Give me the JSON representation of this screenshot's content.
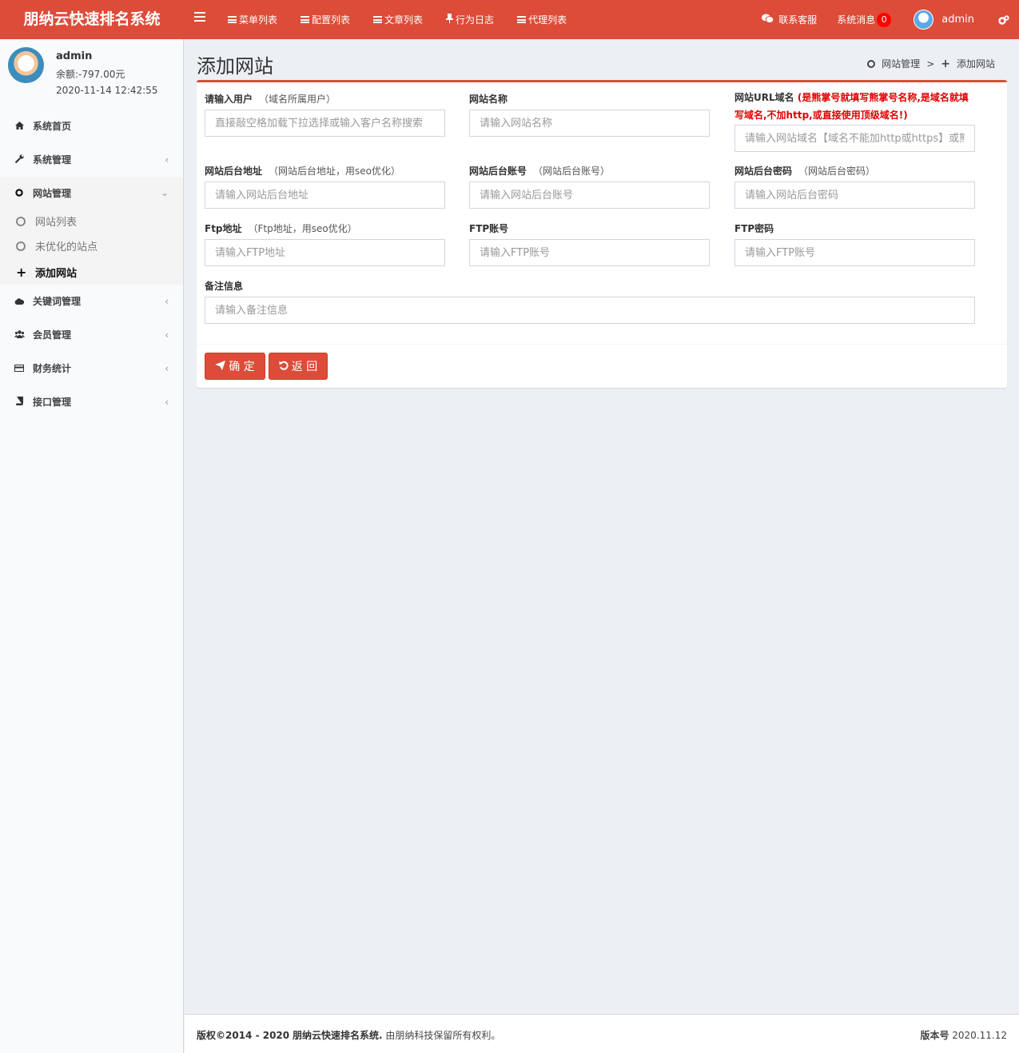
{
  "app": {
    "title": "朋纳云快速排名系统"
  },
  "topnav": [
    {
      "label": "菜单列表",
      "icon": "list-icon"
    },
    {
      "label": "配置列表",
      "icon": "list-icon"
    },
    {
      "label": "文章列表",
      "icon": "list-icon"
    },
    {
      "label": "行为日志",
      "icon": "thumbtack-icon"
    },
    {
      "label": "代理列表",
      "icon": "list-icon"
    }
  ],
  "header_right": {
    "support": "联系客服",
    "messages": "系统消息",
    "message_count": "0",
    "user": "admin"
  },
  "user_panel": {
    "name": "admin",
    "balance": "余额:-797.00元",
    "time": "2020-11-14 12:42:55"
  },
  "sidebar": {
    "items": [
      {
        "label": "系统首页",
        "icon": "home-icon"
      },
      {
        "label": "系统管理",
        "icon": "wrench-icon"
      },
      {
        "label": "网站管理",
        "icon": "circle-icon"
      },
      {
        "label": "关键词管理",
        "icon": "cloud-icon"
      },
      {
        "label": "会员管理",
        "icon": "users-icon"
      },
      {
        "label": "财务统计",
        "icon": "credit-card-icon"
      },
      {
        "label": "接口管理",
        "icon": "book-icon"
      }
    ],
    "subitems": [
      {
        "label": "网站列表"
      },
      {
        "label": "未优化的站点"
      },
      {
        "label": "添加网站"
      }
    ]
  },
  "page": {
    "title": "添加网站",
    "breadcrumb": [
      "网站管理",
      "添加网站"
    ],
    "breadcrumb_sep": ">"
  },
  "form": {
    "user": {
      "label": "请输入用户",
      "hint": "（域名所属用户）",
      "placeholder": "直接敲空格加载下拉选择或输入客户名称搜索"
    },
    "site_name": {
      "label": "网站名称",
      "placeholder": "请输入网站名称"
    },
    "site_url": {
      "label": "网站URL域名",
      "warning": "(是熊掌号就填写熊掌号名称,是域名就填写域名,不加http,或直接使用顶级域名!)",
      "placeholder": "请输入网站域名【域名不能加http或https】或熊掌号名称"
    },
    "admin_url": {
      "label": "网站后台地址",
      "hint": "（网站后台地址，用seo优化）",
      "placeholder": "请输入网站后台地址"
    },
    "admin_account": {
      "label": "网站后台账号",
      "hint": "（网站后台账号）",
      "placeholder": "请输入网站后台账号"
    },
    "admin_password": {
      "label": "网站后台密码",
      "hint": "（网站后台密码）",
      "placeholder": "请输入网站后台密码"
    },
    "ftp_addr": {
      "label": "Ftp地址",
      "hint": "（Ftp地址，用seo优化）",
      "placeholder": "请输入FTP地址"
    },
    "ftp_account": {
      "label": "FTP账号",
      "placeholder": "请输入FTP账号"
    },
    "ftp_password": {
      "label": "FTP密码",
      "placeholder": "请输入FTP账号"
    },
    "remark": {
      "label": "备注信息",
      "placeholder": "请输入备注信息"
    },
    "submit": "确 定",
    "back": "返 回"
  },
  "footer": {
    "copyright_prefix": "版权©2014 - 2020",
    "company": "朋纳云快速排名系统.",
    "rights": "由朋纳科技保留所有权利。",
    "version_label": "版本号",
    "version": "2020.11.12"
  },
  "colors": {
    "brand": "#dd4b39",
    "warning_text": "#e00000",
    "badge": "#ff0000"
  }
}
